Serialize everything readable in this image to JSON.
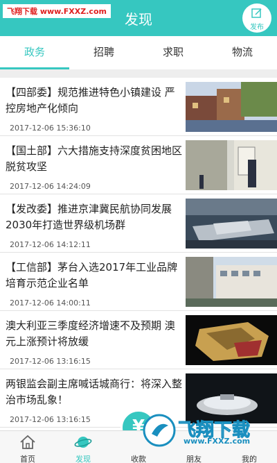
{
  "header": {
    "title": "发现",
    "watermark": "飞翔下载 www.FXXZ.com",
    "publish_label": "发布"
  },
  "tabs": [
    {
      "label": "政务"
    },
    {
      "label": "招聘"
    },
    {
      "label": "求职"
    },
    {
      "label": "物流"
    }
  ],
  "news": [
    {
      "title": "【四部委】规范推进特色小镇建设 严控房地产化倾向",
      "date": "2017-12-06 15:36:10"
    },
    {
      "title": "【国土部】六大措施支持深度贫困地区脱贫攻坚",
      "date": "2017-12-06 14:24:09"
    },
    {
      "title": "【发改委】推进京津冀民航协同发展 2030年打造世界级机场群",
      "date": "2017-12-06 14:12:11"
    },
    {
      "title": "【工信部】茅台入选2017年工业品牌培育示范企业名单",
      "date": "2017-12-06 14:00:11"
    },
    {
      "title": "澳大利亚三季度经济增速不及预期 澳元上涨预计将放缓",
      "date": "2017-12-06 13:16:15"
    },
    {
      "title": "两银监会副主席喊话城商行：将深入整治市场乱象！",
      "date": "2017-12-06 13:16:15"
    }
  ],
  "footer": {
    "items": [
      {
        "label": "首页"
      },
      {
        "label": "发现"
      },
      {
        "label": "收款"
      },
      {
        "label": "朋友"
      },
      {
        "label": "我的"
      }
    ]
  },
  "brand_overlay": {
    "text": "飞翔下载",
    "url": "www.FXXZ.com"
  },
  "colors": {
    "accent": "#36c7c0",
    "divider": "#eeeeee"
  }
}
